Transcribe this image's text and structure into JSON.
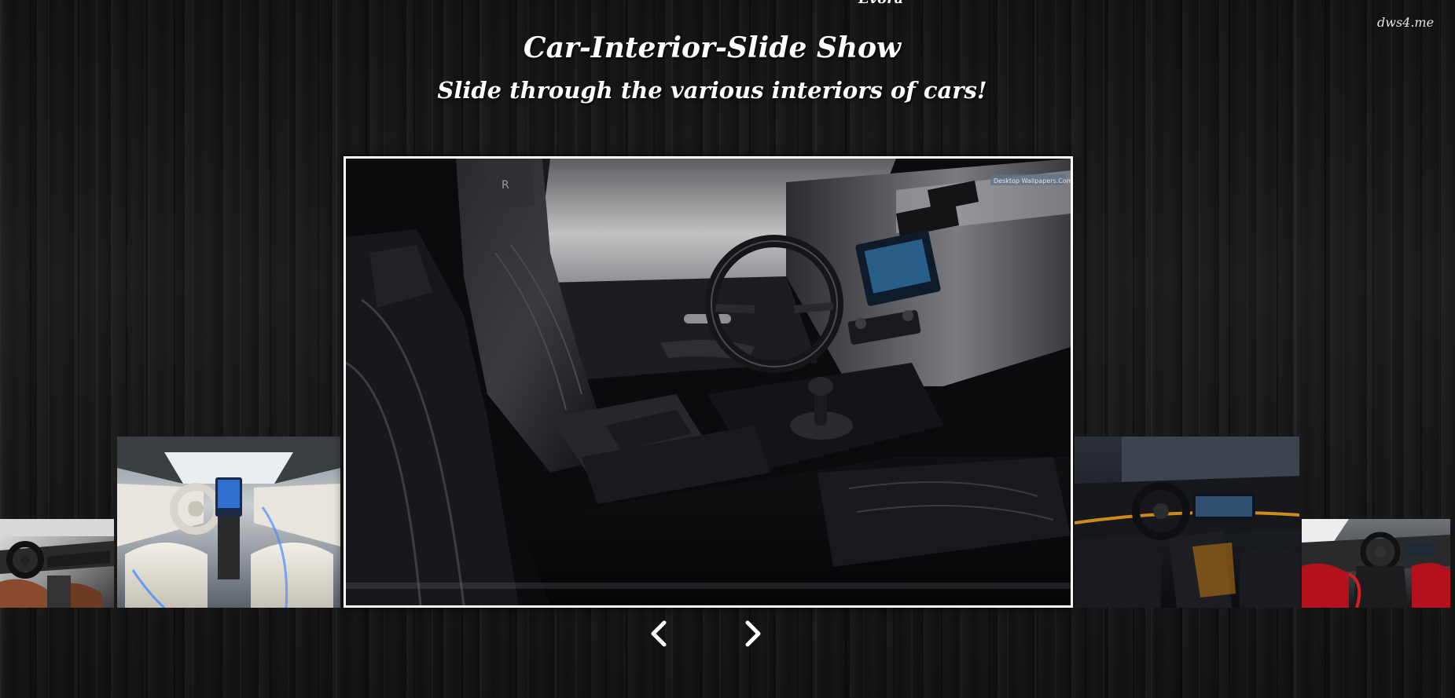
{
  "header": {
    "top_clip_text": "Evora",
    "watermark": "dws4.me",
    "title": "Car-Interior-Slide Show",
    "subtitle": "Slide through the various interiors of cars!"
  },
  "slides": {
    "main": {
      "description": "black leather sport interior",
      "brand_badge": "R",
      "overlay_text": "Desktop Wallpapers.Com"
    },
    "thumbnails": [
      "dark interior with brown seats",
      "white concept interior",
      "dark interior with ambient lighting",
      "red and black sports interior"
    ]
  },
  "navigation": {
    "prev_icon": "chevron-left-icon",
    "next_icon": "chevron-right-icon"
  },
  "colors": {
    "background": "#141414",
    "text": "#ffffff",
    "main_border": "#ffffff"
  }
}
